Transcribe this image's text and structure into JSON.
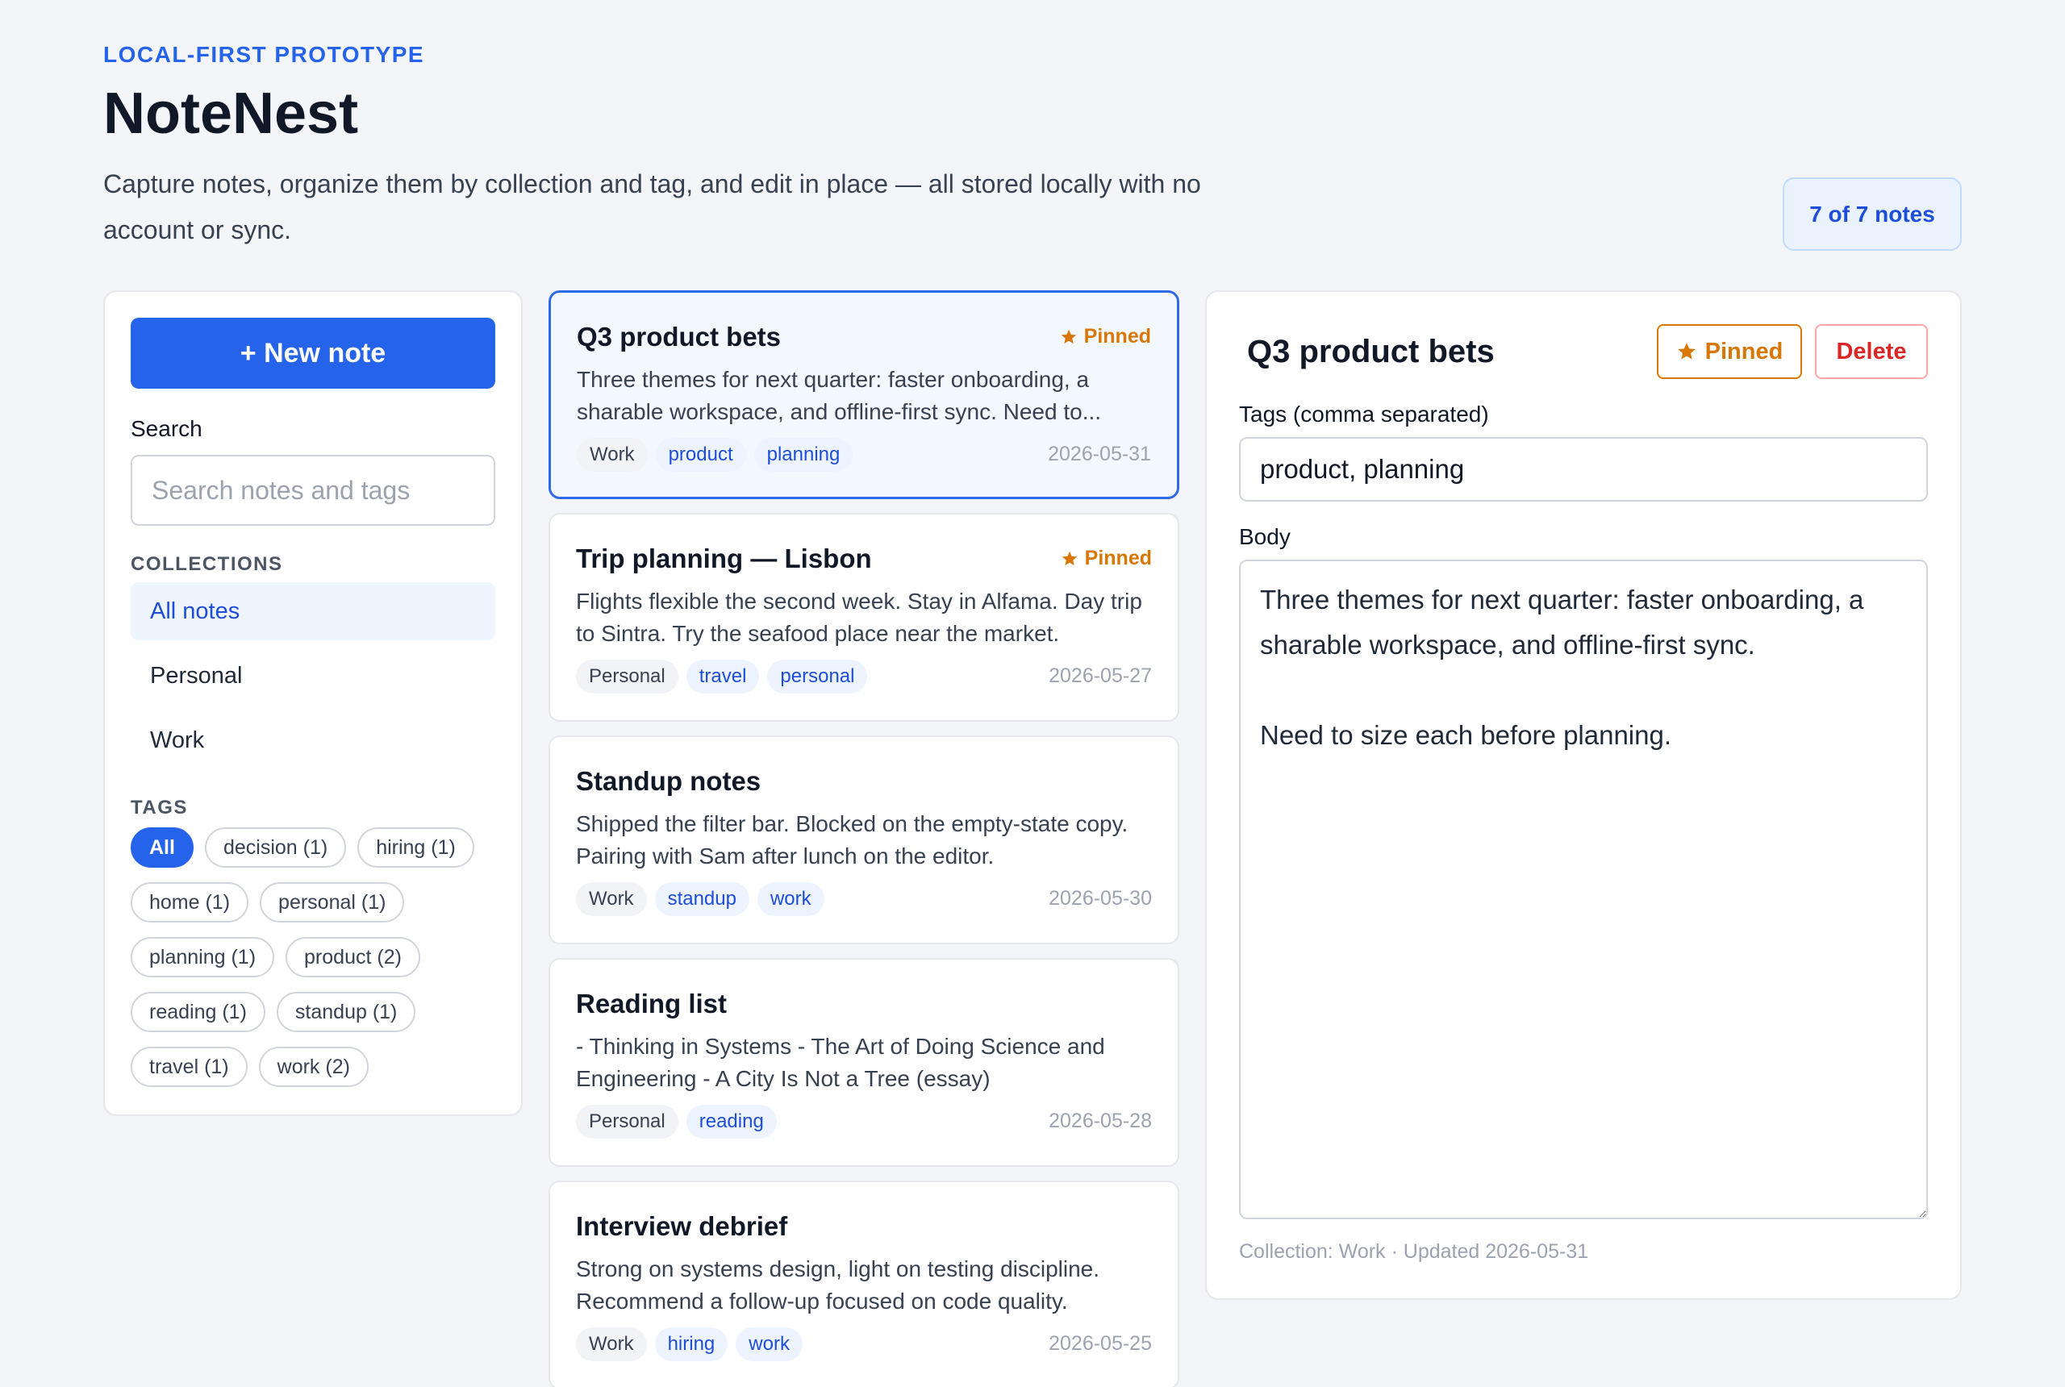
{
  "header": {
    "eyebrow": "LOCAL-FIRST PROTOTYPE",
    "title": "NoteNest",
    "subtitle": "Capture notes, organize them by collection and tag, and edit in place — all stored locally with no account or sync.",
    "count_badge": "7 of 7 notes"
  },
  "sidebar": {
    "new_note_label": "+ New note",
    "search_label": "Search",
    "search_placeholder": "Search notes and tags",
    "collections_heading": "COLLECTIONS",
    "collections": [
      {
        "label": "All notes",
        "active": true
      },
      {
        "label": "Personal",
        "active": false
      },
      {
        "label": "Work",
        "active": false
      }
    ],
    "tags_heading": "TAGS",
    "tags": [
      {
        "label": "All",
        "active": true
      },
      {
        "label": "decision (1)",
        "active": false
      },
      {
        "label": "hiring (1)",
        "active": false
      },
      {
        "label": "home (1)",
        "active": false
      },
      {
        "label": "personal (1)",
        "active": false
      },
      {
        "label": "planning (1)",
        "active": false
      },
      {
        "label": "product (2)",
        "active": false
      },
      {
        "label": "reading (1)",
        "active": false
      },
      {
        "label": "standup (1)",
        "active": false
      },
      {
        "label": "travel (1)",
        "active": false
      },
      {
        "label": "work (2)",
        "active": false
      }
    ]
  },
  "notes": [
    {
      "title": "Q3 product bets",
      "pinned": "Pinned",
      "snippet": "Three themes for next quarter: faster onboarding, a sharable workspace, and offline-first sync. Need to...",
      "collection": "Work",
      "tags": [
        "product",
        "planning"
      ],
      "date": "2026-05-31",
      "selected": true
    },
    {
      "title": "Trip planning — Lisbon",
      "pinned": "Pinned",
      "snippet": "Flights flexible the second week. Stay in Alfama. Day trip to Sintra. Try the seafood place near the market.",
      "collection": "Personal",
      "tags": [
        "travel",
        "personal"
      ],
      "date": "2026-05-27",
      "selected": false
    },
    {
      "title": "Standup notes",
      "pinned": "",
      "snippet": "Shipped the filter bar. Blocked on the empty-state copy. Pairing with Sam after lunch on the editor.",
      "collection": "Work",
      "tags": [
        "standup",
        "work"
      ],
      "date": "2026-05-30",
      "selected": false
    },
    {
      "title": "Reading list",
      "pinned": "",
      "snippet": "- Thinking in Systems - The Art of Doing Science and Engineering - A City Is Not a Tree (essay)",
      "collection": "Personal",
      "tags": [
        "reading"
      ],
      "date": "2026-05-28",
      "selected": false
    },
    {
      "title": "Interview debrief",
      "pinned": "",
      "snippet": "Strong on systems design, light on testing discipline. Recommend a follow-up focused on code quality.",
      "collection": "Work",
      "tags": [
        "hiring",
        "work"
      ],
      "date": "2026-05-25",
      "selected": false
    }
  ],
  "editor": {
    "title": "Q3 product bets",
    "pin_label": "Pinned",
    "delete_label": "Delete",
    "tags_label": "Tags (comma separated)",
    "tags_value": "product, planning",
    "body_label": "Body",
    "body_value": "Three themes for next quarter: faster onboarding, a sharable workspace, and offline-first sync.\n\nNeed to size each before planning.",
    "footer": "Collection: Work · Updated 2026-05-31"
  },
  "icons": {
    "pin": "star-icon"
  },
  "colors": {
    "accent": "#2563eb",
    "pinned": "#d97706",
    "danger": "#dc2626"
  }
}
